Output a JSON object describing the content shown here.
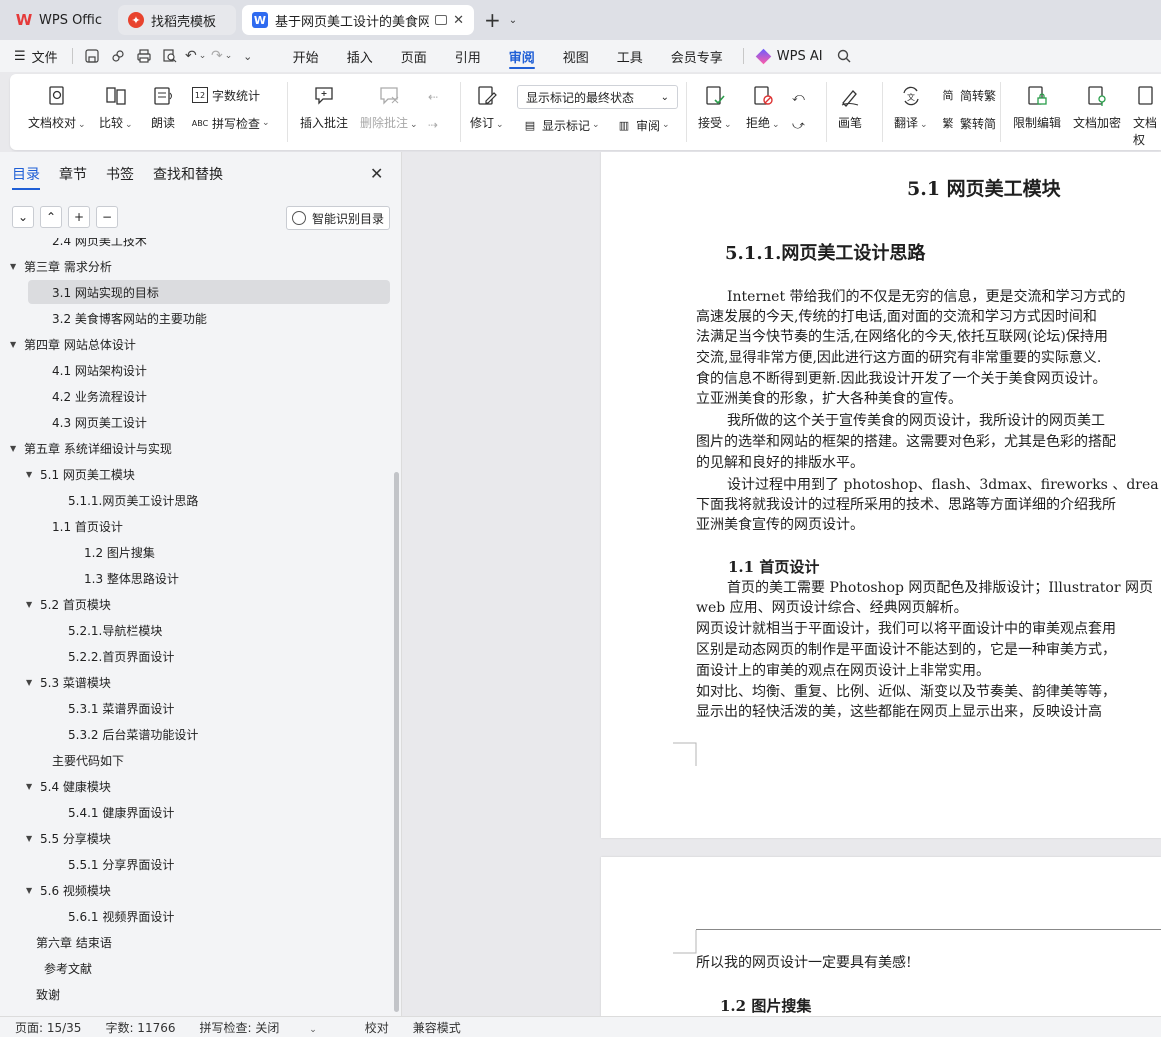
{
  "tabs": [
    {
      "label": "WPS Office"
    },
    {
      "label": "找稻壳模板"
    },
    {
      "label": "基于网页美工设计的美食网店的"
    }
  ],
  "menu": {
    "file": "文件",
    "tabs": [
      "开始",
      "插入",
      "页面",
      "引用",
      "审阅",
      "视图",
      "工具",
      "会员专享"
    ],
    "active_tab": "审阅",
    "ai": "WPS AI"
  },
  "ribbon": {
    "proofread": "文档校对",
    "compare": "比较",
    "read_aloud": "朗读",
    "word_count": "字数统计",
    "spell_check": "拼写检查",
    "insert_comment": "插入批注",
    "delete_comment": "删除批注",
    "revise": "修订",
    "display_select": "显示标记的最终状态",
    "show_markup": "显示标记",
    "review": "审阅",
    "accept": "接受",
    "reject": "拒绝",
    "pen": "画笔",
    "translate": "翻译",
    "to_traditional": "简转繁",
    "to_simplified": "繁转简",
    "restrict_edit": "限制编辑",
    "encrypt": "文档加密",
    "doc_permission": "文档权"
  },
  "nav": {
    "tabs": [
      "目录",
      "章节",
      "书签",
      "查找和替换"
    ],
    "active": "目录",
    "smart_toc": "智能识别目录",
    "toc": [
      {
        "label": "2.4 网页美工技术",
        "level": 2,
        "arrow": false,
        "selected": false
      },
      {
        "label": "第三章 需求分析",
        "level": 1,
        "arrow": true,
        "selected": false
      },
      {
        "label": "3.1 网站实现的目标",
        "level": 2,
        "arrow": false,
        "selected": true
      },
      {
        "label": "3.2 美食博客网站的主要功能",
        "level": 2,
        "arrow": false,
        "selected": false
      },
      {
        "label": "第四章 网站总体设计",
        "level": 1,
        "arrow": true,
        "selected": false
      },
      {
        "label": "4.1 网站架构设计",
        "level": 2,
        "arrow": false,
        "selected": false
      },
      {
        "label": "4.2 业务流程设计",
        "level": 2,
        "arrow": false,
        "selected": false
      },
      {
        "label": "4.3 网页美工设计",
        "level": 2,
        "arrow": false,
        "selected": false
      },
      {
        "label": "第五章 系统详细设计与实现",
        "level": 1,
        "arrow": true,
        "selected": false
      },
      {
        "label": "5.1 网页美工模块",
        "level": 2,
        "arrow": true,
        "selected": false
      },
      {
        "label": "5.1.1.网页美工设计思路",
        "level": 3,
        "arrow": false,
        "selected": false
      },
      {
        "label": "1.1 首页设计",
        "level": 2,
        "arrow": false,
        "selected": false
      },
      {
        "label": "1.2 图片搜集",
        "level": 3,
        "arrow": false,
        "selected": false,
        "extra": 2
      },
      {
        "label": "1.3 整体思路设计",
        "level": 3,
        "arrow": false,
        "selected": false,
        "extra": 2
      },
      {
        "label": "5.2 首页模块",
        "level": 2,
        "arrow": true,
        "selected": false
      },
      {
        "label": "5.2.1.导航栏模块",
        "level": 3,
        "arrow": false,
        "selected": false
      },
      {
        "label": "5.2.2.首页界面设计",
        "level": 3,
        "arrow": false,
        "selected": false
      },
      {
        "label": "5.3 菜谱模块",
        "level": 2,
        "arrow": true,
        "selected": false
      },
      {
        "label": "5.3.1 菜谱界面设计",
        "level": 3,
        "arrow": false,
        "selected": false
      },
      {
        "label": "5.3.2 后台菜谱功能设计",
        "level": 3,
        "arrow": false,
        "selected": false
      },
      {
        "label": "主要代码如下",
        "level": 2,
        "arrow": false,
        "selected": false
      },
      {
        "label": "5.4 健康模块",
        "level": 2,
        "arrow": true,
        "selected": false
      },
      {
        "label": "5.4.1  健康界面设计",
        "level": 3,
        "arrow": false,
        "selected": false
      },
      {
        "label": "5.5 分享模块",
        "level": 2,
        "arrow": true,
        "selected": false
      },
      {
        "label": "5.5.1 分享界面设计",
        "level": 3,
        "arrow": false,
        "selected": false
      },
      {
        "label": "5.6 视频模块",
        "level": 2,
        "arrow": true,
        "selected": false
      },
      {
        "label": "5.6.1 视频界面设计",
        "level": 3,
        "arrow": false,
        "selected": false
      },
      {
        "label": "第六章  结束语",
        "level": 1,
        "arrow": false,
        "selected": false
      },
      {
        "label": "参考文献",
        "level": 1,
        "arrow": false,
        "selected": false,
        "extra": 1
      },
      {
        "label": "致谢",
        "level": 1,
        "arrow": false,
        "selected": false
      }
    ]
  },
  "doc": {
    "page1": {
      "h1": "5.1 网页美工模块",
      "h2": "5.1.1.网页美工设计思路",
      "para1": [
        "Internet 带给我们的不仅是无穷的信息，更是交流和学习方式的",
        "高速发展的今天,传统的打电话,面对面的交流和学习方式因时间和",
        "法满足当今快节奏的生活,在网络化的今天,依托互联网(论坛)保持用",
        "交流,显得非常方便,因此进行这方面的研究有非常重要的实际意义.",
        "食的信息不断得到更新.因此我设计开发了一个关于美食网页设计。",
        "立亚洲美食的形象，扩大各种美食的宣传。"
      ],
      "para2": [
        "我所做的这个关于宣传美食的网页设计，我所设计的网页美工",
        "图片的选举和网站的框架的搭建。这需要对色彩，尤其是色彩的搭配",
        "的见解和良好的排版水平。"
      ],
      "para3": [
        "设计过程中用到了 photoshop、flash、3dmax、fireworks 、drea",
        "下面我将就我设计的过程所采用的技术、思路等方面详细的介绍我所",
        "亚洲美食宣传的网页设计。"
      ],
      "h3": "1.1 首页设计",
      "para4": [
        "首页的美工需要 Photoshop 网页配色及排版设计；Illustrator 网页",
        "web 应用、网页设计综合、经典网页解析。",
        "网页设计就相当于平面设计，我们可以将平面设计中的审美观点套用",
        "区别是动态网页的制作是平面设计不能达到的，它是一种审美方式，",
        "面设计上的审美的观点在网页设计上非常实用。",
        "如对比、均衡、重复、比例、近似、渐变以及节奏美、韵律美等等，",
        "显示出的轻快活泼的美，这些都能在网页上显示出来，反映设计高"
      ]
    },
    "page2": {
      "line1": "所以我的网页设计一定要具有美感!",
      "h3": "1.2 图片搜集"
    }
  },
  "status": {
    "page": "页面: 15/35",
    "words": "字数: 11766",
    "spell": "拼写检查: 关闭",
    "proof": "校对",
    "compat": "兼容模式"
  },
  "colors": {
    "accent": "#1f5fd6",
    "wps_red": "#e53a3a",
    "doc_blue": "#2f6bf0"
  }
}
